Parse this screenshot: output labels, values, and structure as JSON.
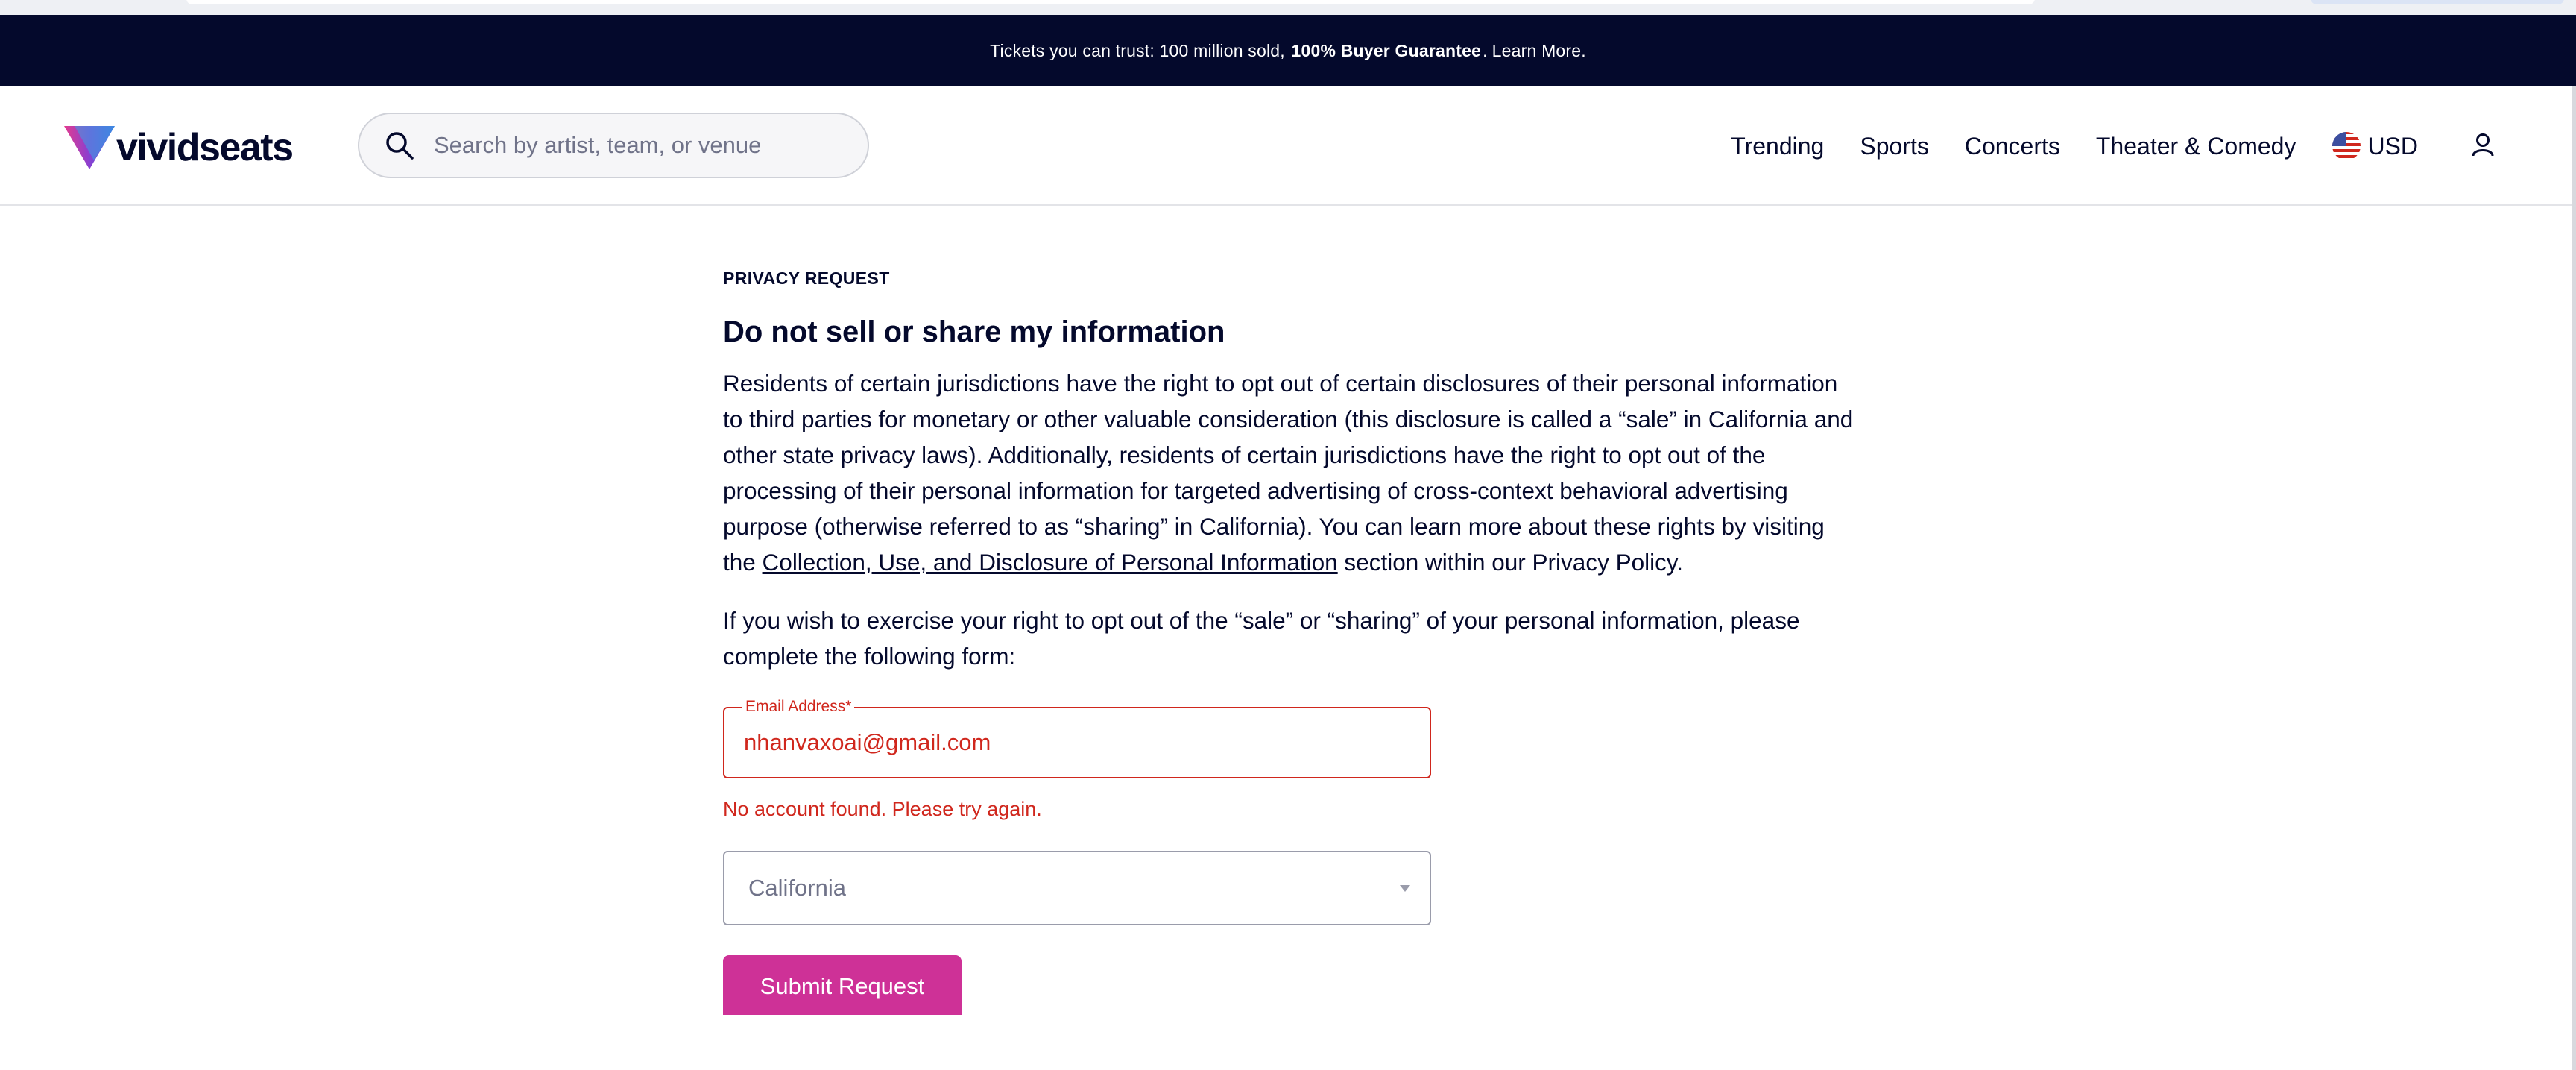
{
  "banner": {
    "prefix": "Tickets you can trust: 100 million sold,",
    "guarantee": "100% Buyer Guarantee",
    "suffix": ".",
    "learn_more": "Learn More."
  },
  "header": {
    "logo_text": "vividseats",
    "search_placeholder": "Search by artist, team, or venue",
    "search_value": "",
    "nav": [
      "Trending",
      "Sports",
      "Concerts",
      "Theater & Comedy"
    ],
    "currency": "USD"
  },
  "main": {
    "eyebrow": "PRIVACY REQUEST",
    "title": "Do not sell or share my information",
    "para1_before_link": "Residents of certain jurisdictions have the right to opt out of certain disclosures of their personal information to third parties for monetary or other valuable consideration (this disclosure is called a “sale” in California and other state privacy laws). Additionally, residents of certain jurisdictions have the right to opt out of the processing of their personal information for targeted advertising of cross-context behavioral advertising purpose (otherwise referred to as “sharing” in California). You can learn more about these rights by visiting the ",
    "para1_link": "Collection, Use, and Disclosure of Personal Information",
    "para1_after_link": " section within our Privacy Policy.",
    "para2": "If you wish to exercise your right to opt out of the “sale” or “sharing” of your personal information, please complete the following form:",
    "email_label": "Email Address*",
    "email_value": "nhanvaxoai@gmail.com",
    "email_error": "No account found. Please try again.",
    "state_value": "California",
    "submit_label": "Submit Request"
  },
  "colors": {
    "banner_bg": "#04092c",
    "error": "#d0271d",
    "submit_bg": "#ce3197"
  },
  "icons": {
    "search": "search-icon",
    "flag": "us-flag-icon",
    "user": "user-icon",
    "caret": "caret-down-icon",
    "logo": "vividseats-logo-icon"
  }
}
